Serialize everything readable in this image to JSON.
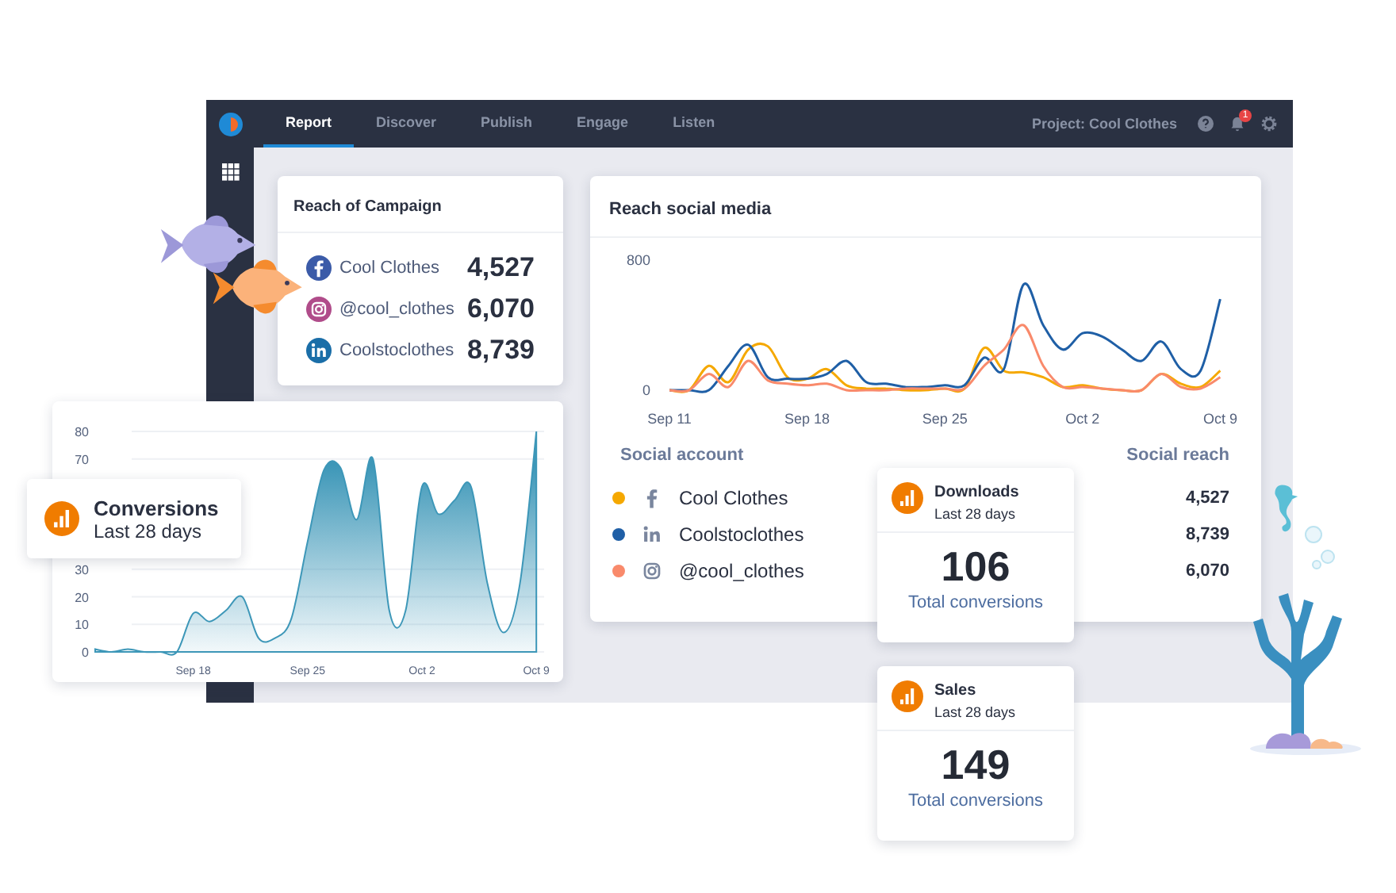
{
  "nav": {
    "tabs": [
      {
        "label": "Report",
        "selected": true
      },
      {
        "label": "Discover",
        "selected": false
      },
      {
        "label": "Publish",
        "selected": false
      },
      {
        "label": "Engage",
        "selected": false
      },
      {
        "label": "Listen",
        "selected": false
      }
    ],
    "project": "Project: Cool Clothes",
    "notifications": "1"
  },
  "campaign_card": {
    "title": "Reach of Campaign",
    "rows": [
      {
        "kind": "facebook",
        "name": "Cool Clothes",
        "value": "4,527"
      },
      {
        "kind": "instagram",
        "name": "@cool_clothes",
        "value": "6,070"
      },
      {
        "kind": "linkedin",
        "name": "Coolstoclothes",
        "value": "8,739"
      }
    ]
  },
  "social_card": {
    "title": "Reach social media",
    "chart_data": {
      "type": "line",
      "categories": [
        "Sep 11",
        null,
        null,
        null,
        null,
        null,
        null,
        "Sep 18",
        null,
        null,
        null,
        null,
        null,
        null,
        "Sep 25",
        null,
        null,
        null,
        null,
        null,
        null,
        "Oct 2",
        null,
        null,
        null,
        null,
        null,
        null,
        "Oct 9"
      ],
      "series": [
        {
          "color": "#f5a800",
          "values": [
            0,
            0,
            150,
            50,
            250,
            270,
            80,
            70,
            130,
            30,
            10,
            10,
            0,
            0,
            10,
            10,
            260,
            120,
            110,
            80,
            20,
            30,
            10,
            0,
            0,
            100,
            40,
            20,
            120
          ]
        },
        {
          "color": "#1f5fa6",
          "values": [
            0,
            0,
            0,
            150,
            280,
            80,
            70,
            70,
            100,
            180,
            50,
            40,
            20,
            20,
            30,
            30,
            200,
            130,
            650,
            400,
            250,
            350,
            330,
            250,
            180,
            300,
            130,
            120,
            560
          ]
        },
        {
          "color": "#f98a6b",
          "values": [
            0,
            0,
            100,
            20,
            180,
            60,
            40,
            30,
            40,
            0,
            0,
            0,
            10,
            10,
            10,
            10,
            150,
            250,
            400,
            150,
            20,
            20,
            10,
            0,
            0,
            100,
            20,
            10,
            80
          ]
        }
      ],
      "ylim": [
        0,
        800
      ],
      "yticks": [
        0,
        800
      ]
    },
    "columns": [
      "Social account",
      "Social reach"
    ],
    "rows": [
      {
        "kind": "facebook",
        "color": "#f5a800",
        "name": "Cool Clothes",
        "reach": "4,527"
      },
      {
        "kind": "linkedin",
        "color": "#1f5fa6",
        "name": "Coolstoclothes",
        "reach": "8,739"
      },
      {
        "kind": "instagram",
        "color": "#f98a6b",
        "name": "@cool_clothes",
        "reach": "6,070"
      }
    ]
  },
  "conversions_chart": {
    "chart_data": {
      "type": "area",
      "grid": true,
      "categories": [
        null,
        null,
        null,
        null,
        null,
        null,
        "Sep 18",
        null,
        null,
        null,
        null,
        null,
        null,
        "Sep 25",
        null,
        null,
        null,
        null,
        null,
        null,
        "Oct 2",
        null,
        null,
        null,
        null,
        null,
        null,
        "Oct 9"
      ],
      "series": [
        {
          "color": "#3d97b8",
          "values": [
            1,
            0,
            1,
            0,
            0,
            0,
            14,
            11,
            15,
            20,
            5,
            5,
            12,
            40,
            66,
            67,
            48,
            70,
            15,
            15,
            60,
            50,
            55,
            60,
            25,
            7,
            25,
            80
          ]
        }
      ],
      "ylim": [
        0,
        80
      ],
      "yticks": [
        0,
        10,
        20,
        30,
        70,
        80
      ]
    }
  },
  "conversions_card": {
    "title": "Conversions",
    "subtitle": "Last 28 days"
  },
  "stat_cards": [
    {
      "title": "Downloads",
      "subtitle": "Last 28 days",
      "value": "106",
      "caption": "Total conversions"
    },
    {
      "title": "Sales",
      "subtitle": "Last 28 days",
      "value": "149",
      "caption": "Total conversions"
    }
  ]
}
